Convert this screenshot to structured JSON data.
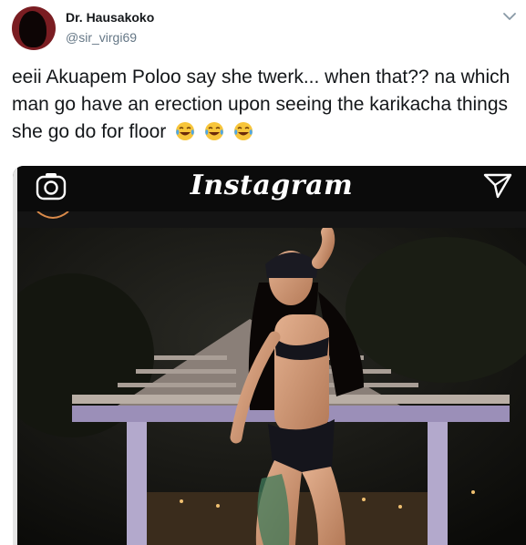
{
  "tweet": {
    "author": {
      "display_name": "Dr. Hausakoko",
      "handle": "@sir_virgi69"
    },
    "text": "eeii Akuapem Poloo say she twerk... when that?? na which man go have an erection upon seeing the karikacha things she go do for floor",
    "emojis": [
      "face-with-tears-of-joy",
      "face-with-tears-of-joy",
      "face-with-tears-of-joy"
    ]
  },
  "media": {
    "app_header": {
      "title": "Instagram"
    },
    "icons": [
      "camera-icon",
      "send-icon"
    ]
  },
  "colors": {
    "name": "#14171a",
    "handle": "#657786",
    "avatar_bg": "#7a1d22",
    "ig_bar": "#0b0b0b"
  }
}
